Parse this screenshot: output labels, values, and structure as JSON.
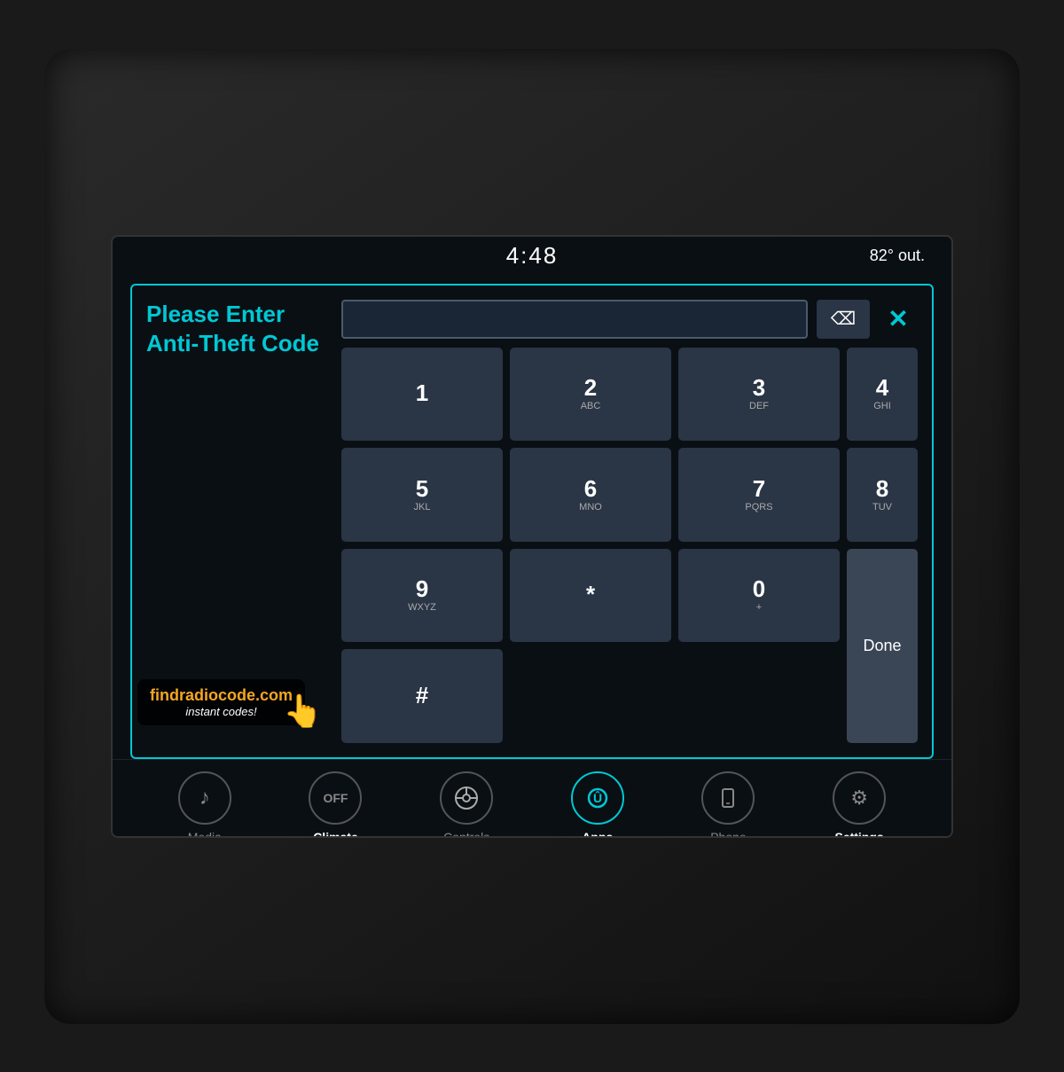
{
  "status_bar": {
    "time": "4:48",
    "temperature": "82° out."
  },
  "dialog": {
    "prompt_line1": "Please Enter",
    "prompt_line2": "Anti-Theft Code",
    "input_value": "",
    "input_placeholder": ""
  },
  "watermark": {
    "url": "findradiocode.com",
    "subtitle": "instant codes!"
  },
  "keypad": {
    "keys": [
      {
        "number": "1",
        "letters": ""
      },
      {
        "number": "2",
        "letters": "ABC"
      },
      {
        "number": "3",
        "letters": "DEF"
      },
      {
        "number": "4",
        "letters": "GHI"
      },
      {
        "number": "5",
        "letters": "JKL"
      },
      {
        "number": "6",
        "letters": "MNO"
      },
      {
        "number": "7",
        "letters": "PQRS"
      },
      {
        "number": "8",
        "letters": "TUV"
      },
      {
        "number": "9",
        "letters": "WXYZ"
      },
      {
        "number": "*",
        "letters": ""
      },
      {
        "number": "0",
        "letters": "+"
      },
      {
        "number": "#",
        "letters": ""
      }
    ],
    "done_label": "Done",
    "backspace_symbol": "⌫"
  },
  "nav": {
    "items": [
      {
        "id": "media",
        "label": "Media",
        "icon": "♪",
        "active": false
      },
      {
        "id": "climate",
        "label": "Climate",
        "icon": "OFF",
        "active": false
      },
      {
        "id": "controls",
        "label": "Controls",
        "icon": "⚙",
        "active": false
      },
      {
        "id": "apps",
        "label": "Apps",
        "icon": "Û",
        "active": true
      },
      {
        "id": "phone",
        "label": "Phone",
        "icon": "📱",
        "active": false
      },
      {
        "id": "settings",
        "label": "Settings",
        "icon": "⚙",
        "active": false
      }
    ]
  },
  "close_label": "✕"
}
